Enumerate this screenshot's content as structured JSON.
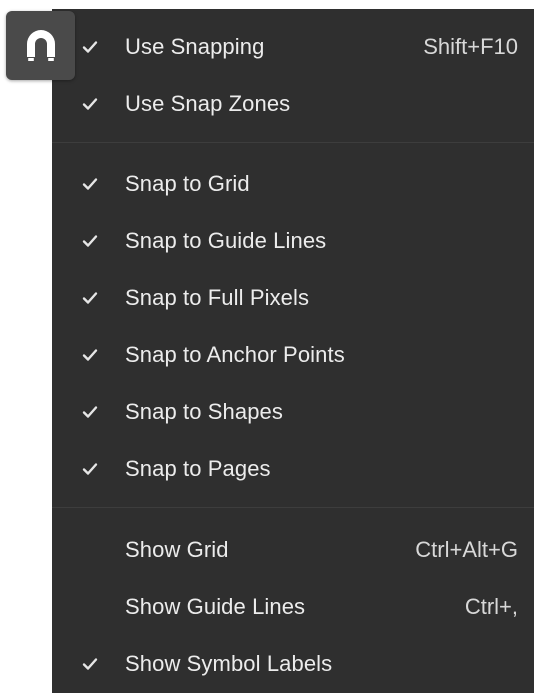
{
  "snap_button": {
    "icon": "magnet-icon"
  },
  "menu": {
    "groups": [
      [
        {
          "name": "use-snapping",
          "label": "Use Snapping",
          "shortcut": "Shift+F10",
          "checked": true
        },
        {
          "name": "use-snap-zones",
          "label": "Use Snap Zones",
          "shortcut": "",
          "checked": true
        }
      ],
      [
        {
          "name": "snap-to-grid",
          "label": "Snap to Grid",
          "shortcut": "",
          "checked": true
        },
        {
          "name": "snap-to-guide-lines",
          "label": "Snap to Guide Lines",
          "shortcut": "",
          "checked": true
        },
        {
          "name": "snap-to-full-pixels",
          "label": "Snap to Full Pixels",
          "shortcut": "",
          "checked": true
        },
        {
          "name": "snap-to-anchor-points",
          "label": "Snap to Anchor Points",
          "shortcut": "",
          "checked": true
        },
        {
          "name": "snap-to-shapes",
          "label": "Snap to Shapes",
          "shortcut": "",
          "checked": true
        },
        {
          "name": "snap-to-pages",
          "label": "Snap to Pages",
          "shortcut": "",
          "checked": true
        }
      ],
      [
        {
          "name": "show-grid",
          "label": "Show Grid",
          "shortcut": "Ctrl+Alt+G",
          "checked": false
        },
        {
          "name": "show-guide-lines",
          "label": "Show Guide Lines",
          "shortcut": "Ctrl+,",
          "checked": false
        },
        {
          "name": "show-symbol-labels",
          "label": "Show Symbol Labels",
          "shortcut": "",
          "checked": true
        }
      ]
    ]
  }
}
